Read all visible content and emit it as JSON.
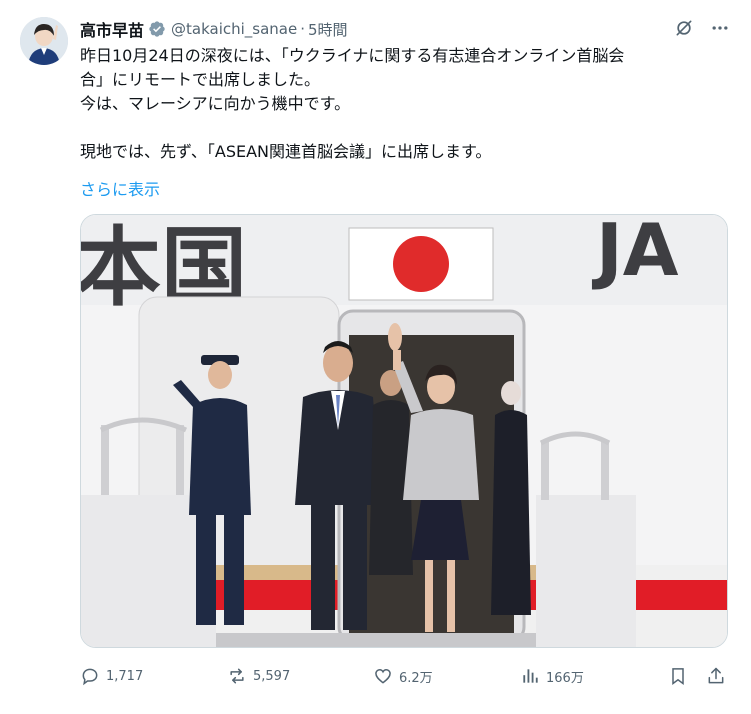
{
  "post": {
    "display_name": "高市早苗",
    "handle": "@takaichi_sanae",
    "separator": "·",
    "time": "5時間",
    "text_lines": [
      "昨日10月24日の深夜には、「ウクライナに関する有志連合オンライン首脳会",
      "合」にリモートで出席しました。",
      "今は、マレーシアに向かう機中です。",
      "現地では、先ず、「ASEAN関連首脳会議」に出席します。"
    ],
    "show_more": "さらに表示"
  },
  "photo": {
    "fuselage_text_left": "本国",
    "fuselage_text_right": "JA"
  },
  "actions": {
    "reply_count": "1,717",
    "repost_count": "5,597",
    "like_count": "6.2万",
    "views_count": "166万"
  },
  "colors": {
    "accent": "#1d9bf0",
    "verified": "#829aab",
    "muted": "#536471"
  },
  "icons": [
    "verified-badge-icon",
    "grok-icon",
    "more-icon",
    "reply-icon",
    "repost-icon",
    "like-icon",
    "views-icon",
    "bookmark-icon",
    "share-icon"
  ]
}
